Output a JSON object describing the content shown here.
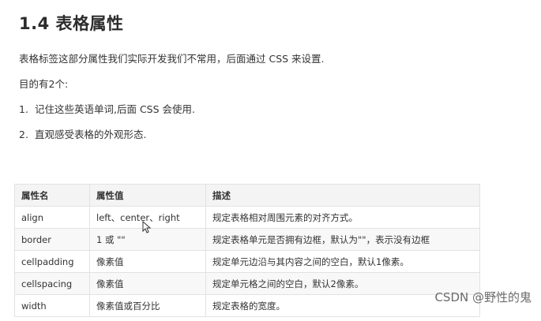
{
  "heading": "1.4 表格属性",
  "intro": "表格标签这部分属性我们实际开发我们不常用，后面通过 CSS 来设置.",
  "purpose": "目的有2个:",
  "goals": [
    {
      "num": "1.",
      "text": "记住这些英语单词,后面 CSS 会使用."
    },
    {
      "num": "2.",
      "text": "直观感受表格的外观形态."
    }
  ],
  "table": {
    "headers": [
      "属性名",
      "属性值",
      "描述"
    ],
    "rows": [
      {
        "name": "align",
        "value": "left、center、right",
        "desc": "规定表格相对周围元素的对齐方式。"
      },
      {
        "name": "border",
        "value": "1 或 \"\"",
        "desc": "规定表格单元是否拥有边框，默认为\"\"，表示没有边框"
      },
      {
        "name": "cellpadding",
        "value": "像素值",
        "desc": "规定单元边沿与其内容之间的空白，默认1像素。"
      },
      {
        "name": "cellspacing",
        "value": "像素值",
        "desc": "规定单元格之间的空白，默认2像素。"
      },
      {
        "name": "width",
        "value": "像素值或百分比",
        "desc": "规定表格的宽度。"
      }
    ]
  },
  "watermark": "CSDN @野性的鬼",
  "icons": {
    "cursor": "mouse-pointer-icon"
  }
}
